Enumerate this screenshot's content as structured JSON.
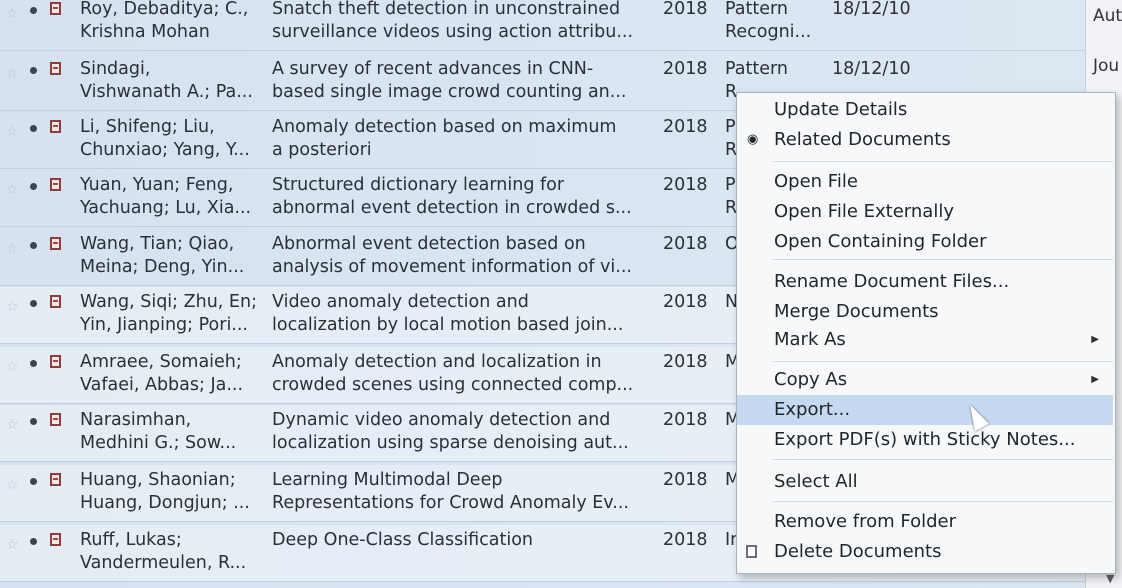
{
  "rows": [
    {
      "authors": [
        "Roy, Debaditya; C.,",
        "Krishna Mohan"
      ],
      "title": [
        "Snatch theft detection in unconstrained",
        "surveillance videos using action attribu..."
      ],
      "year": "2018",
      "publication": [
        "Pattern",
        "Recogni..."
      ],
      "added": "18/12/10"
    },
    {
      "authors": [
        "Sindagi,",
        "Vishwanath A.; Pa..."
      ],
      "title": [
        "A survey of recent advances in CNN-",
        "based single image crowd counting an..."
      ],
      "year": "2018",
      "publication": [
        "Pattern",
        "R"
      ],
      "added": "18/12/10"
    },
    {
      "authors": [
        "Li, Shifeng; Liu,",
        "Chunxiao; Yang, Y..."
      ],
      "title": [
        "Anomaly detection based on maximum",
        "a posteriori"
      ],
      "year": "2018",
      "publication": [
        "P",
        "R"
      ],
      "added": ""
    },
    {
      "authors": [
        "Yuan, Yuan; Feng,",
        "Yachuang; Lu, Xia..."
      ],
      "title": [
        "Structured dictionary learning for",
        "abnormal event detection in crowded s..."
      ],
      "year": "2018",
      "publication": [
        "P",
        "R"
      ],
      "added": ""
    },
    {
      "authors": [
        "Wang, Tian; Qiao,",
        "Meina; Deng, Yin..."
      ],
      "title": [
        "Abnormal event detection based on",
        "analysis of movement information of vi..."
      ],
      "year": "2018",
      "publication": [
        "O",
        ""
      ],
      "added": ""
    },
    {
      "authors": [
        "Wang, Siqi; Zhu, En;",
        "Yin, Jianping; Pori..."
      ],
      "title": [
        "Video anomaly detection and",
        "localization by local motion based join..."
      ],
      "year": "2018",
      "publication": [
        "N",
        ""
      ],
      "added": ""
    },
    {
      "authors": [
        "Amraee, Somaieh;",
        "Vafaei, Abbas; Ja..."
      ],
      "title": [
        "Anomaly detection and localization in",
        "crowded scenes using connected comp..."
      ],
      "year": "2018",
      "publication": [
        "M",
        ""
      ],
      "added": ""
    },
    {
      "authors": [
        "Narasimhan,",
        "Medhini G.; Sow..."
      ],
      "title": [
        "Dynamic video anomaly detection and",
        "localization using sparse denoising aut..."
      ],
      "year": "2018",
      "publication": [
        "M",
        ""
      ],
      "added": ""
    },
    {
      "authors": [
        "Huang, Shaonian;",
        "Huang, Dongjun; ..."
      ],
      "title": [
        "Learning Multimodal Deep",
        "Representations for Crowd Anomaly Ev..."
      ],
      "year": "2018",
      "publication": [
        "M",
        ""
      ],
      "added": ""
    },
    {
      "authors": [
        "Ruff, Lukas;",
        "Vandermeulen, R..."
      ],
      "title": [
        "Deep One-Class Classification",
        ""
      ],
      "year": "2018",
      "publication": [
        "In",
        ""
      ],
      "added": ""
    }
  ],
  "right_column": [
    "Aut",
    "Jou"
  ],
  "menu": [
    {
      "label": "Update Details",
      "icon": "",
      "submenu": false,
      "hover": false
    },
    {
      "label": "Related Documents",
      "icon": "related-documents-icon",
      "submenu": false,
      "hover": false
    },
    {
      "label": "Open File",
      "icon": "",
      "submenu": false,
      "hover": false
    },
    {
      "label": "Open File Externally",
      "icon": "",
      "submenu": false,
      "hover": false
    },
    {
      "label": "Open Containing Folder",
      "icon": "",
      "submenu": false,
      "hover": false
    },
    {
      "label": "Rename Document Files...",
      "icon": "",
      "submenu": false,
      "hover": false
    },
    {
      "label": "Merge Documents",
      "icon": "",
      "submenu": false,
      "hover": false
    },
    {
      "label": "Mark As",
      "icon": "",
      "submenu": true,
      "hover": false
    },
    {
      "label": "Copy As",
      "icon": "",
      "submenu": true,
      "hover": false
    },
    {
      "label": "Export...",
      "icon": "",
      "submenu": false,
      "hover": true
    },
    {
      "label": "Export PDF(s) with Sticky Notes...",
      "icon": "",
      "submenu": false,
      "hover": false
    },
    {
      "label": "Select All",
      "icon": "",
      "submenu": false,
      "hover": false
    },
    {
      "label": "Remove from Folder",
      "icon": "",
      "submenu": false,
      "hover": false
    },
    {
      "label": "Delete Documents",
      "icon": "delete-document-icon",
      "submenu": false,
      "hover": false
    }
  ],
  "colors": {
    "selection": "#d6e2ef",
    "menu_hover": "#c5d9f1",
    "pdf_icon": "#8f3c3c"
  }
}
